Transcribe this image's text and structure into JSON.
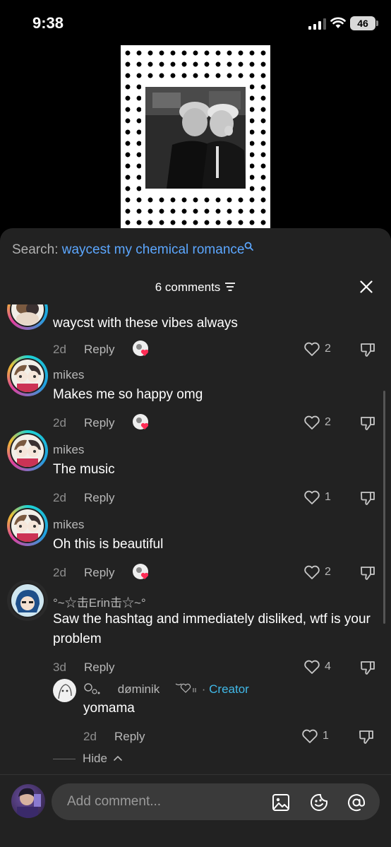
{
  "status_bar": {
    "time": "9:38",
    "battery": "46"
  },
  "search": {
    "prefix": "Search:",
    "term": "waycest my chemical romance"
  },
  "comments_header": {
    "count_label": "6 comments"
  },
  "comments": [
    {
      "username": "",
      "text": "waycst with these vibes always",
      "age": "2d",
      "reply_label": "Reply",
      "likes": "2",
      "creator_liked": true
    },
    {
      "username": "mikes",
      "text": "Makes me so happy omg",
      "age": "2d",
      "reply_label": "Reply",
      "likes": "2",
      "creator_liked": true
    },
    {
      "username": "mikes",
      "text": "The music",
      "age": "2d",
      "reply_label": "Reply",
      "likes": "1",
      "creator_liked": false
    },
    {
      "username": "mikes",
      "text": "Oh this is beautiful",
      "age": "2d",
      "reply_label": "Reply",
      "likes": "2",
      "creator_liked": true
    },
    {
      "username": "°~☆击Erin击☆~°",
      "text": "Saw the hashtag and immediately disliked, wtf is your problem",
      "age": "3d",
      "reply_label": "Reply",
      "likes": "4",
      "creator_liked": false
    }
  ],
  "reply": {
    "username": "døminik",
    "creator_label": "Creator",
    "text": "yomama",
    "age": "2d",
    "reply_label": "Reply",
    "likes": "1"
  },
  "hide_label": "Hide",
  "composer": {
    "placeholder": "Add comment..."
  },
  "colors": {
    "panel": "#222222",
    "accent_link": "#5ca7ff",
    "creator": "#41b9e8",
    "heart_red": "#fe2c55"
  },
  "icons": [
    "search-icon",
    "filter-icon",
    "close-icon",
    "heart-outline-icon",
    "dislike-icon",
    "image-icon",
    "sticker-icon",
    "at-icon"
  ]
}
